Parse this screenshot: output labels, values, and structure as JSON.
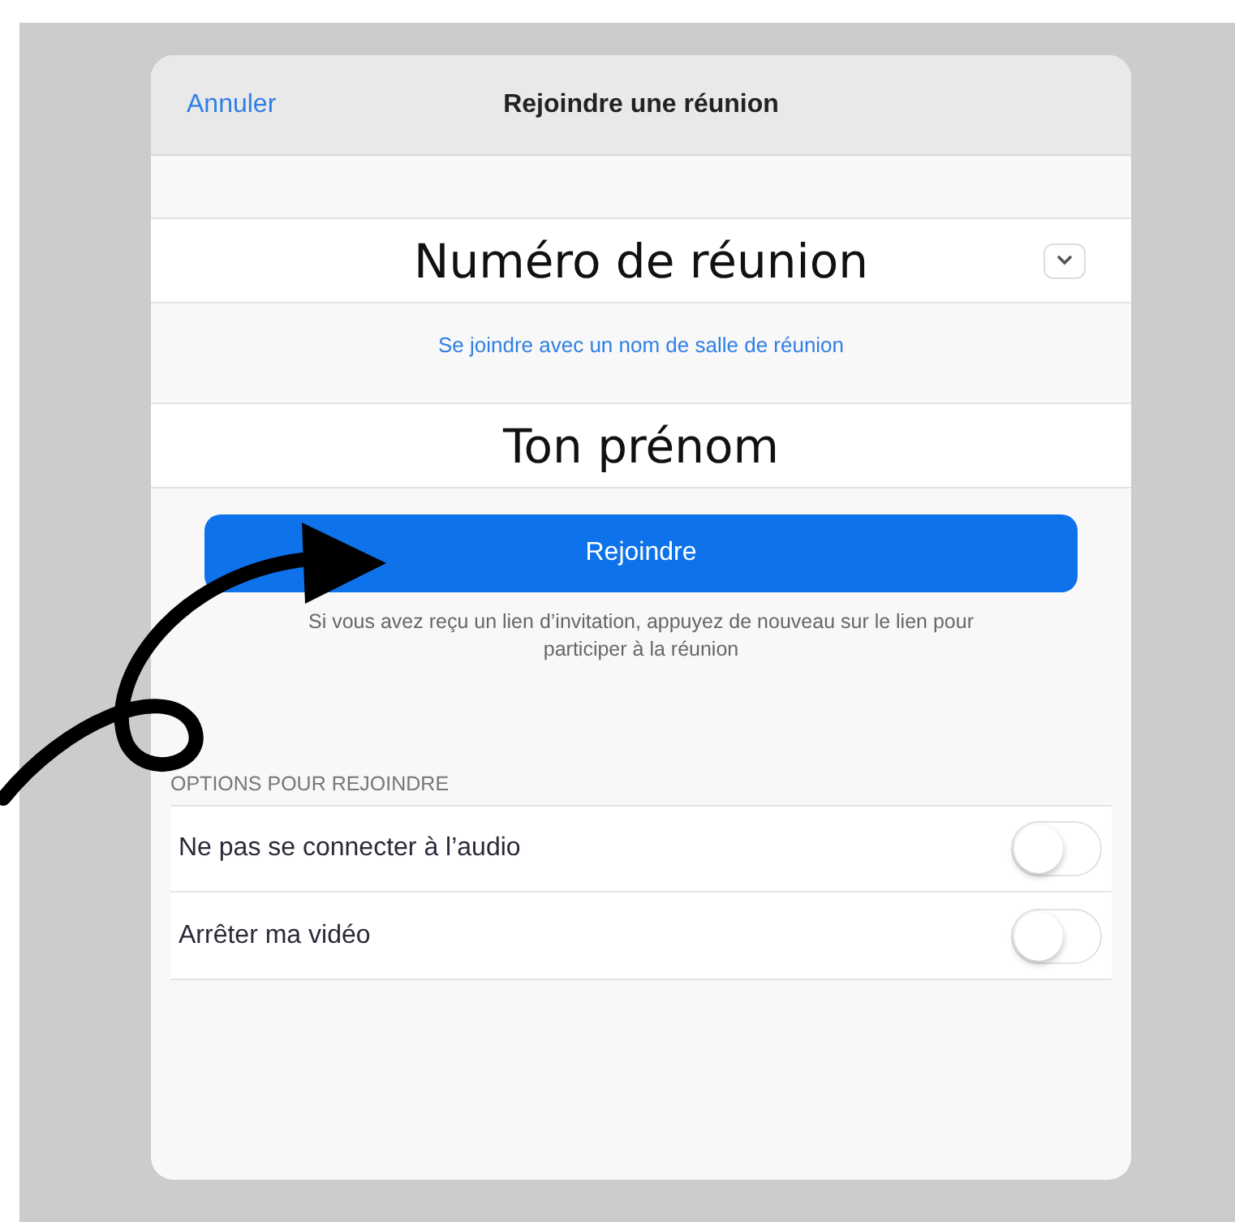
{
  "header": {
    "cancel": "Annuler",
    "title": "Rejoindre une réunion"
  },
  "meeting_field": {
    "placeholder": "Numéro de réunion"
  },
  "room_link": "Se joindre avec un nom de salle de réunion",
  "name_field": {
    "placeholder": "Ton prénom"
  },
  "join_button": "Rejoindre",
  "hint": "Si vous avez reçu un lien d’invitation, appuyez de nouveau sur le lien pour participer à la réunion",
  "options_header": "OPTIONS POUR REJOINDRE",
  "options": [
    {
      "label": "Ne pas se connecter à l’audio",
      "on": false
    },
    {
      "label": "Arrêter ma vidéo",
      "on": false
    }
  ]
}
